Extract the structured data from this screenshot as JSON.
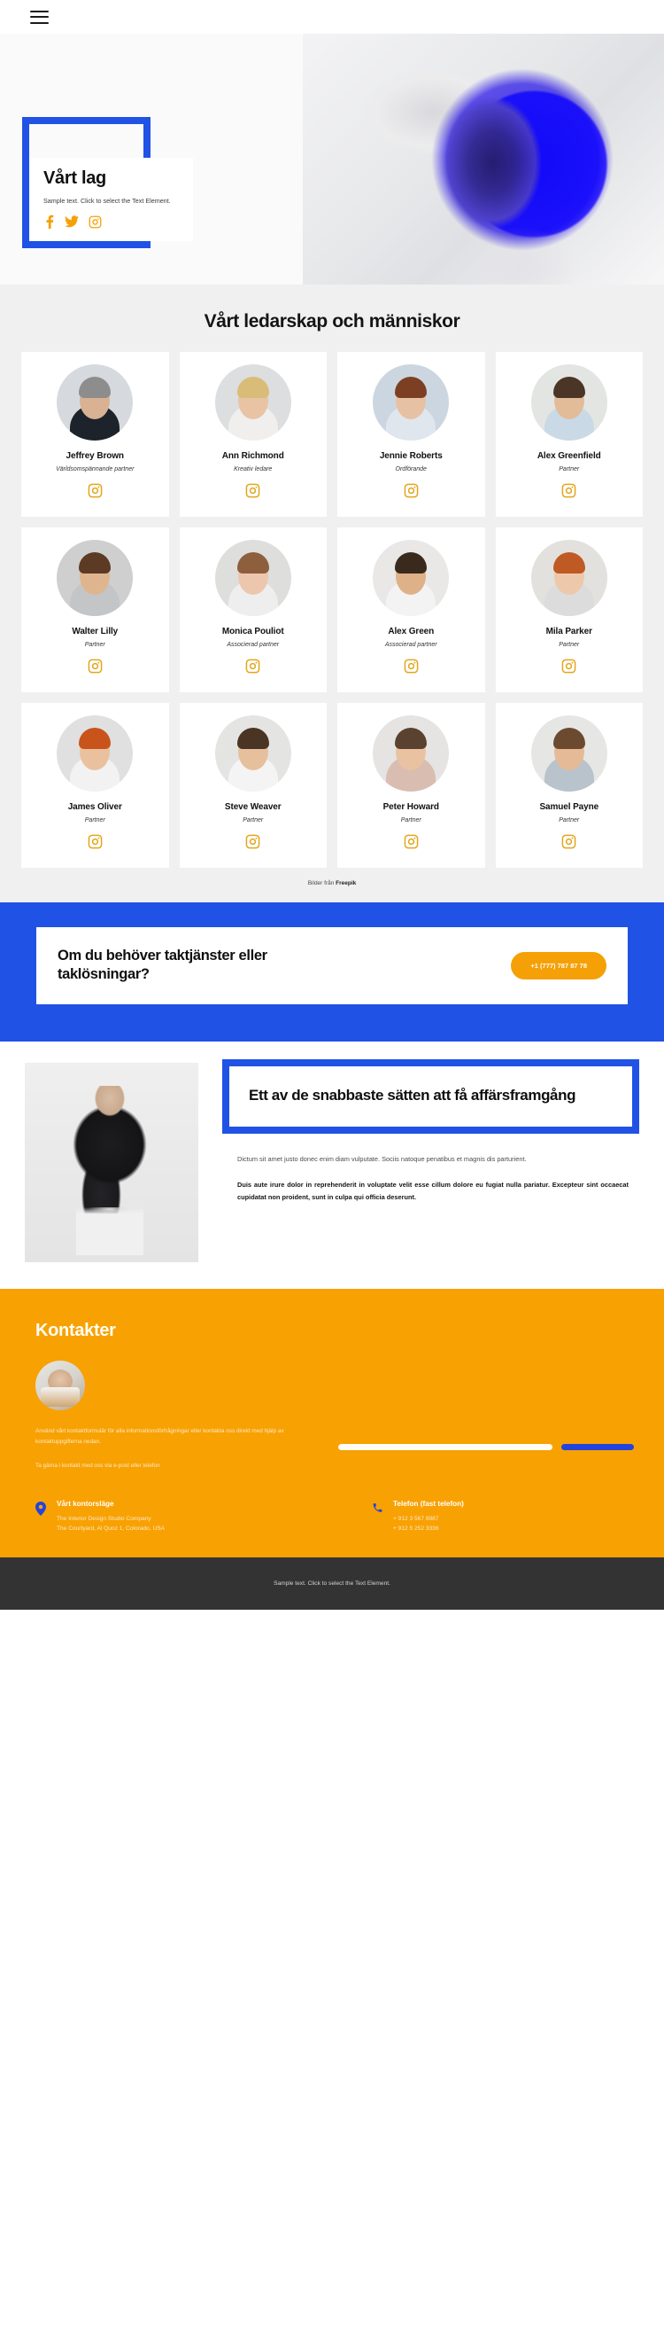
{
  "topbar": {
    "menu_icon": "hamburger-menu-icon"
  },
  "hero": {
    "title": "Vårt lag",
    "subtitle": "Sample text. Click to select the Text Element.",
    "socials": [
      {
        "name": "facebook-icon",
        "label": "Facebook"
      },
      {
        "name": "twitter-icon",
        "label": "Twitter"
      },
      {
        "name": "instagram-icon",
        "label": "Instagram"
      }
    ],
    "accent_color": "#2152e6"
  },
  "team": {
    "heading": "Vårt ledarskap och människor",
    "credit_prefix": "Bilder från ",
    "credit_link": "Freepik",
    "social_icon": "instagram-icon",
    "members": [
      {
        "name": "Jeffrey Brown",
        "role": "Världsomspännande partner",
        "skin": "#d8b293",
        "hair": "#8d8d8d",
        "cloth": "#1d232b",
        "bg": "#d6dade"
      },
      {
        "name": "Ann Richmond",
        "role": "Kreativ ledare",
        "skin": "#e8c3a4",
        "hair": "#d8bc78",
        "cloth": "#f0efed",
        "bg": "#dcdedf"
      },
      {
        "name": "Jennie Roberts",
        "role": "Ordförande",
        "skin": "#e7c1a3",
        "hair": "#7d3f24",
        "cloth": "#dfe6ee",
        "bg": "#ccd6e0"
      },
      {
        "name": "Alex Greenfield",
        "role": "Partner",
        "skin": "#e2bb99",
        "hair": "#4a3526",
        "cloth": "#c9dae6",
        "bg": "#e3e5e2"
      },
      {
        "name": "Walter Lilly",
        "role": "Partner",
        "skin": "#dfb58f",
        "hair": "#5d3a24",
        "cloth": "#c3c5c6",
        "bg": "#cfcfcf"
      },
      {
        "name": "Monica Pouliot",
        "role": "Associerad partner",
        "skin": "#ecc7ad",
        "hair": "#8d5f3c",
        "cloth": "#eeeeee",
        "bg": "#dededd"
      },
      {
        "name": "Alex Green",
        "role": "Associerad partner",
        "skin": "#dfb188",
        "hair": "#3a2a1e",
        "cloth": "#f3f3f3",
        "bg": "#e9e8e6"
      },
      {
        "name": "Mila Parker",
        "role": "Partner",
        "skin": "#eec8ab",
        "hair": "#c05a24",
        "cloth": "#dcdcdc",
        "bg": "#e2e1de"
      },
      {
        "name": "James Oliver",
        "role": "Partner",
        "skin": "#eac19e",
        "hair": "#c8541b",
        "cloth": "#f2f2f2",
        "bg": "#e0e0e0"
      },
      {
        "name": "Steve Weaver",
        "role": "Partner",
        "skin": "#e6bf9d",
        "hair": "#4a3424",
        "cloth": "#f4f4f4",
        "bg": "#e4e4e3"
      },
      {
        "name": "Peter Howard",
        "role": "Partner",
        "skin": "#e9c2a1",
        "hair": "#5a4230",
        "cloth": "#d9bdb1",
        "bg": "#e5e4e2"
      },
      {
        "name": "Samuel Payne",
        "role": "Partner",
        "skin": "#e4bb96",
        "hair": "#6b4a30",
        "cloth": "#b9c3cc",
        "bg": "#e6e6e5"
      }
    ]
  },
  "cta": {
    "headline": "Om du behöver taktjänster eller taklösningar?",
    "phone_button": "+1 (777) 787 87 78",
    "bg_color": "#2152e6",
    "button_color": "#f5a006"
  },
  "success": {
    "heading": "Ett av de snabbaste sätten att få affärsframgång",
    "paragraph_light": "Dictum sit amet justo donec enim diam vulputate. Sociis natoque penatibus et magnis dis parturient.",
    "paragraph_bold": "Duis aute irure dolor in reprehenderit in voluptate velit esse cillum dolore eu fugiat nulla pariatur. Excepteur sint occaecat cupidatat non proident, sunt in culpa qui officia deserunt."
  },
  "contacts": {
    "heading": "Kontakter",
    "intro": "Använd vårt kontaktformulär för alla informationsförfrågningar eller kontakta oss direkt med hjälp av kontaktuppgifterna nedan.",
    "secondary": "Ta gärna i kontakt med oss via e-post eller telefon",
    "form": {
      "input_placeholder": "",
      "input_value": "",
      "submit_label": ""
    },
    "office": {
      "icon": "location-pin-icon",
      "title": "Vårt kontorsläge",
      "line1": "The Interior Design Studio Company",
      "line2": "The Courtyard, Al Quoz 1, Colorado, USA"
    },
    "phone": {
      "icon": "phone-icon",
      "title": "Telefon (fast telefon)",
      "line1": "+ 912 3 567 8987",
      "line2": "+ 912 5 252 3336"
    },
    "bg_color": "#f8a102"
  },
  "footer": {
    "text": "Sample text. Click to select the Text Element.",
    "bg_color": "#333333"
  }
}
